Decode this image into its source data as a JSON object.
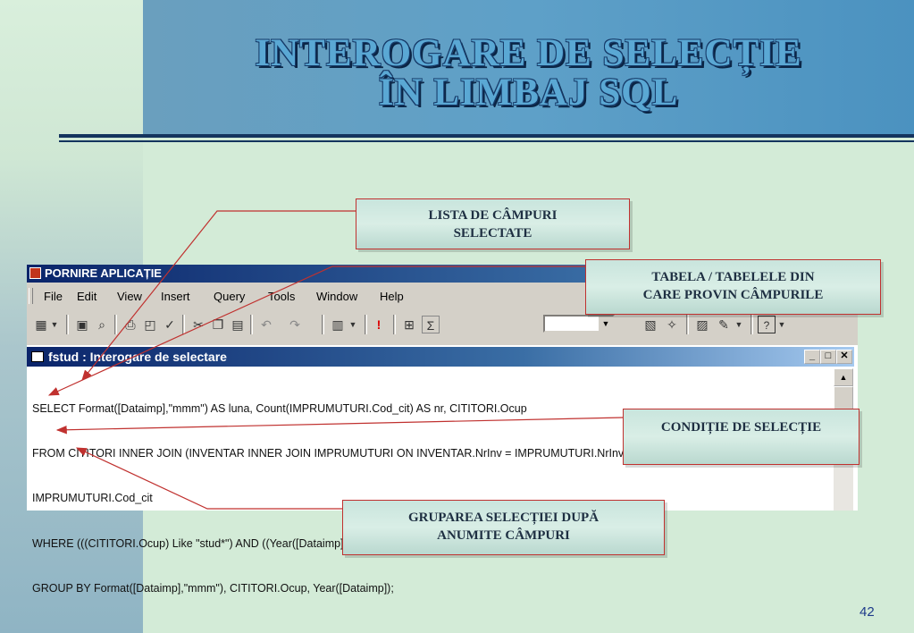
{
  "slide": {
    "title_line1": "INTEROGARE DE SELECȚIE",
    "title_line2": "ÎN LIMBAJ SQL",
    "page_number": "42",
    "colors": {
      "accent": "#c0312f",
      "title": "#5aa8d4",
      "rule": "#14345e"
    }
  },
  "app": {
    "title": "PORNIRE APLICAȚIE",
    "menu": [
      "File",
      "Edit",
      "View",
      "Insert",
      "Query",
      "Tools",
      "Window",
      "Help"
    ],
    "toolbar_icons": [
      "datasheet-view-icon",
      "save-icon",
      "search-icon",
      "print-icon",
      "print-preview-icon",
      "spelling-icon",
      "cut-icon",
      "copy-icon",
      "paste-icon",
      "undo-icon",
      "redo-icon",
      "query-type-icon",
      "run-icon",
      "show-table-icon",
      "totals-icon",
      "properties-icon",
      "build-icon",
      "database-window-icon",
      "new-object-icon",
      "help-icon"
    ]
  },
  "query_window": {
    "title": "fstud : Interogare de selectare",
    "sql_lines": [
      "SELECT Format([Dataimp],\"mmm\") AS luna, Count(IMPRUMUTURI.Cod_cit) AS nr, CITITORI.Ocup",
      "FROM CITITORI INNER JOIN (INVENTAR INNER JOIN IMPRUMUTURI ON INVENTAR.NrInv = IMPRUMUTURI.NrInv) ON CITITORI.Codcit =",
      "IMPRUMUTURI.Cod_cit",
      "WHERE (((CITITORI.Ocup) Like \"stud*\") AND ((Year([Dataimp]))=Year(Date())-1))",
      "GROUP BY Format([Dataimp],\"mmm\"), CITITORI.Ocup, Year([Dataimp]);"
    ]
  },
  "callouts": {
    "fields_line1": "LISTA DE CÂMPURI",
    "fields_line2": "SELECTATE",
    "tables_line1": "TABELA / TABELELE  DIN",
    "tables_line2": "CARE PROVIN CÂMPURILE",
    "condition": "CONDIȚIE DE SELECȚIE",
    "grouping_line1": "GRUPAREA SELECȚIEI DUPĂ",
    "grouping_line2": "ANUMITE CÂMPURI"
  }
}
